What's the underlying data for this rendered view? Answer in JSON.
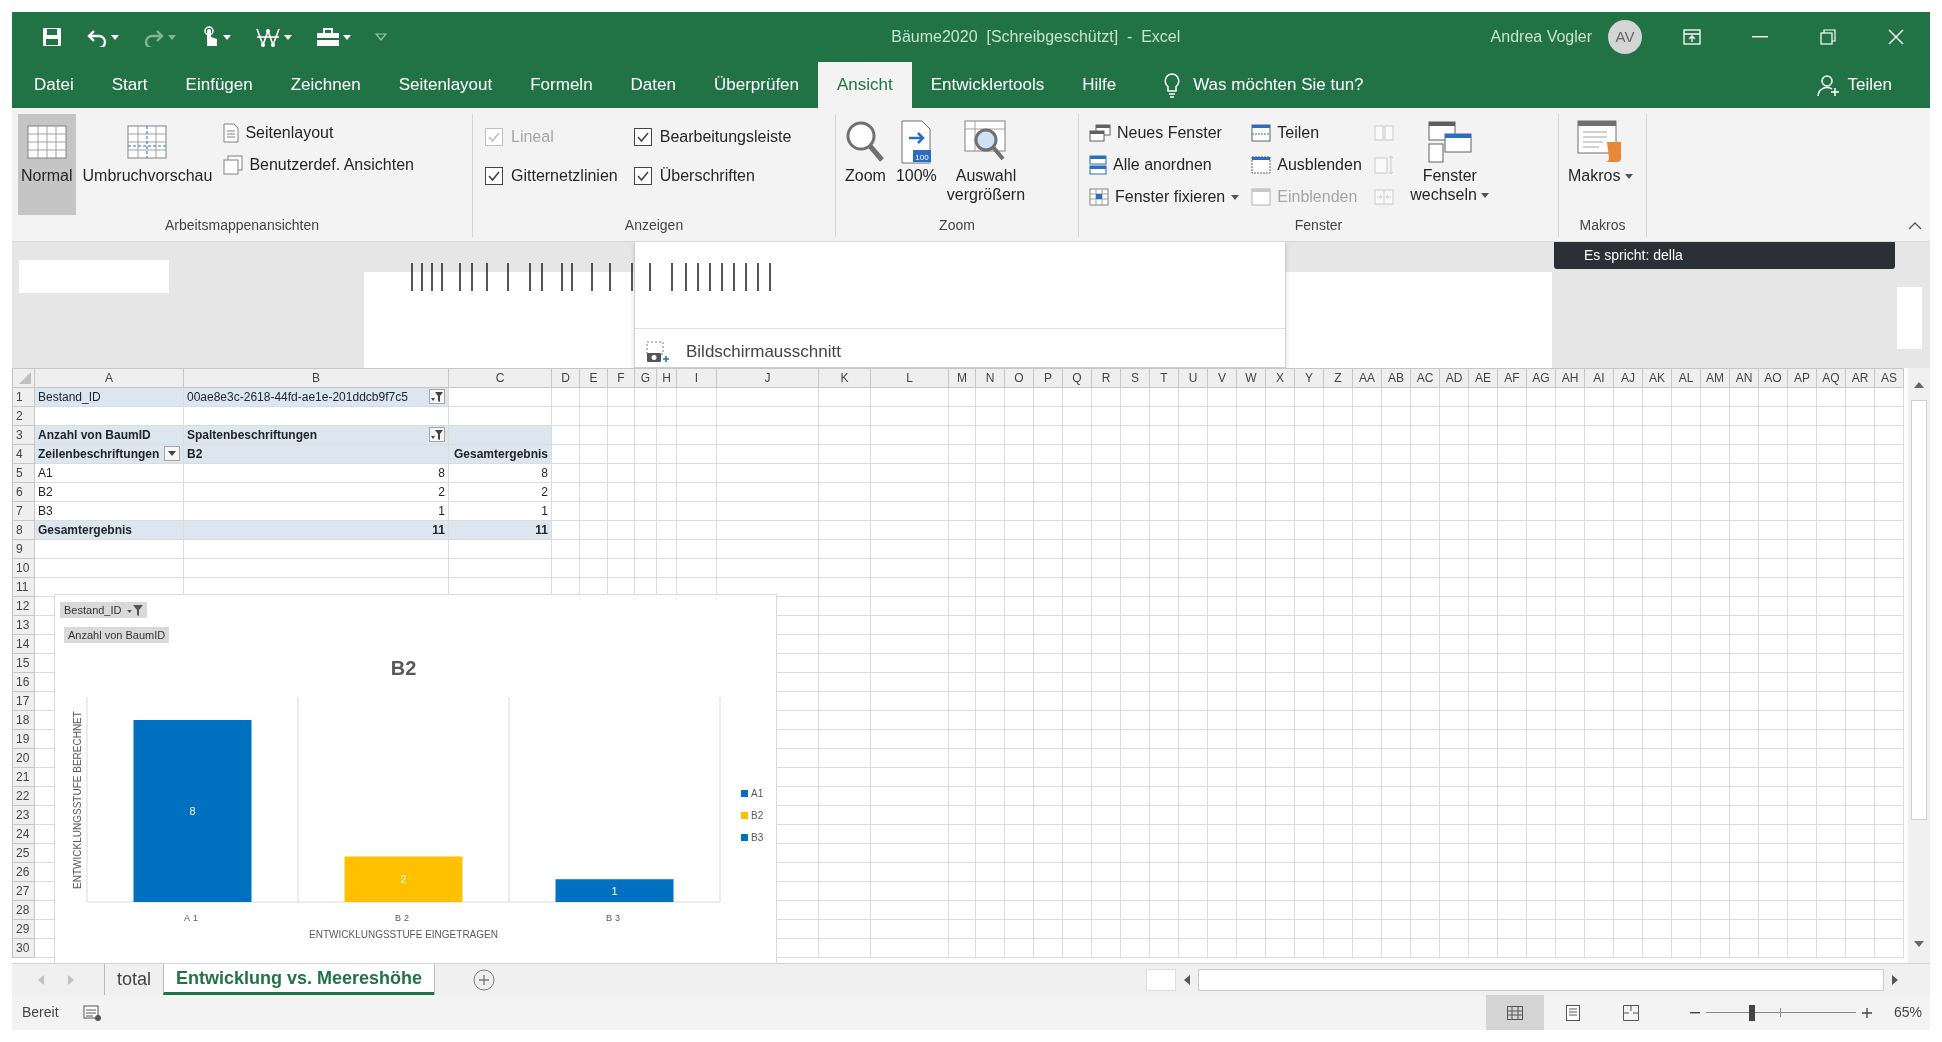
{
  "title_bar": {
    "title": "Bäume2020  [Schreibgeschützt]  -  Excel",
    "user": "Andrea Vogler",
    "avatar": "AV"
  },
  "quick_access": [
    {
      "disabled": false,
      "dropdown": false
    },
    {
      "disabled": false,
      "dropdown": true
    },
    {
      "disabled": true,
      "dropdown": true
    },
    {
      "disabled": false,
      "dropdown": true
    },
    {
      "disabled": false,
      "dropdown": true
    },
    {
      "disabled": false,
      "dropdown": true
    }
  ],
  "ribbon_tabs": [
    {
      "label": "Datei",
      "selected": false
    },
    {
      "label": "Start",
      "selected": false
    },
    {
      "label": "Einfügen",
      "selected": false
    },
    {
      "label": "Zeichnen",
      "selected": false
    },
    {
      "label": "Seitenlayout",
      "selected": false
    },
    {
      "label": "Formeln",
      "selected": false
    },
    {
      "label": "Daten",
      "selected": false
    },
    {
      "label": "Überprüfen",
      "selected": false
    },
    {
      "label": "Ansicht",
      "selected": true
    },
    {
      "label": "Entwicklertools",
      "selected": false
    },
    {
      "label": "Hilfe",
      "selected": false
    }
  ],
  "tell_me": "Was möchten Sie tun?",
  "share": "Teilen",
  "ribbon_groups": [
    {
      "label": "Arbeitsmappenansichten",
      "items": [
        {
          "kind": "large",
          "label": "Normal",
          "selected": true
        },
        {
          "kind": "large",
          "label": "Umbruchvorschau",
          "selected": false
        },
        {
          "kind": "stack",
          "items": [
            {
              "kind": "small",
              "label": "Seitenlayout",
              "disabled": false
            },
            {
              "kind": "small",
              "label": "Benutzerdef. Ansichten",
              "disabled": false
            }
          ]
        }
      ]
    },
    {
      "label": "Anzeigen",
      "items": [
        {
          "kind": "stack",
          "items": [
            {
              "kind": "checkbox",
              "label": "Lineal",
              "checked": true,
              "disabled": true
            },
            {
              "kind": "checkbox",
              "label": "Gitternetzlinien",
              "checked": true,
              "disabled": false
            }
          ]
        },
        {
          "kind": "stack",
          "items": [
            {
              "kind": "checkbox",
              "label": "Bearbeitungsleiste",
              "checked": true,
              "disabled": false
            },
            {
              "kind": "checkbox",
              "label": "Überschriften",
              "checked": true,
              "disabled": false
            }
          ]
        }
      ]
    },
    {
      "label": "Zoom",
      "items": [
        {
          "kind": "large",
          "label": "Zoom"
        },
        {
          "kind": "large",
          "label": "100%",
          "icon_text": "100"
        },
        {
          "kind": "large",
          "label": "Auswahl vergrößern"
        }
      ]
    },
    {
      "label": "Fenster",
      "items": [
        {
          "kind": "stack",
          "items": [
            {
              "kind": "small",
              "label": "Neues Fenster",
              "disabled": false
            },
            {
              "kind": "small",
              "label": "Alle anordnen",
              "disabled": false
            },
            {
              "kind": "small",
              "label": "Fenster fixieren",
              "disabled": false,
              "dropdown": true
            }
          ]
        },
        {
          "kind": "stack",
          "items": [
            {
              "kind": "small",
              "label": "Teilen",
              "disabled": false
            },
            {
              "kind": "small",
              "label": "Ausblenden",
              "disabled": false
            },
            {
              "kind": "small",
              "label": "Einblenden",
              "disabled": true
            }
          ]
        },
        {
          "kind": "stack",
          "items": [
            {
              "kind": "icon",
              "disabled": true
            },
            {
              "kind": "icon",
              "disabled": true
            },
            {
              "kind": "icon",
              "disabled": true
            }
          ]
        },
        {
          "kind": "large",
          "label": "Fenster wechseln",
          "dropdown": true
        }
      ]
    },
    {
      "label": "Makros",
      "items": [
        {
          "kind": "large",
          "label": "Makros",
          "dropdown": true
        }
      ]
    }
  ],
  "screenshot_menu": {
    "label": "Bildschirmausschnitt"
  },
  "tooltip": {
    "text": "Es spricht: della"
  },
  "sheet": {
    "columns": [
      "A",
      "B",
      "C",
      "D",
      "E",
      "F",
      "G",
      "H",
      "I",
      "J",
      "K",
      "L",
      "M",
      "N",
      "O",
      "P",
      "Q",
      "R",
      "S",
      "T",
      "U",
      "V",
      "W",
      "X",
      "Y",
      "Z",
      "AA",
      "AB",
      "AC",
      "AD",
      "AE",
      "AF",
      "AG",
      "AH",
      "AI",
      "AJ",
      "AK",
      "AL",
      "AM",
      "AN",
      "AO",
      "AP",
      "AQ",
      "AR",
      "AS"
    ],
    "rows": [
      {
        "header": "1",
        "cells": [
          {
            "text": "Bestand_ID",
            "shaded": true,
            "bold": false,
            "kind": "label"
          },
          {
            "text": "00ae8e3c-2618-44fd-ae1e-201ddcb9f7c5",
            "shaded": true,
            "bold": false,
            "kind": "label",
            "button": {
              "kind": "filter"
            }
          }
        ]
      },
      {
        "header": "2"
      },
      {
        "header": "3",
        "cells": [
          {
            "text": "Anzahl von BaumID",
            "shaded": true,
            "bold": true,
            "kind": "label"
          },
          {
            "text": "Spaltenbeschriftungen",
            "shaded": true,
            "bold": true,
            "kind": "label",
            "button": {
              "kind": "filter"
            }
          },
          {
            "shaded": true
          }
        ]
      },
      {
        "header": "4",
        "cells": [
          {
            "text": "Zeilenbeschriftungen",
            "shaded": true,
            "bold": true,
            "kind": "label",
            "button": {
              "kind": "dropdown"
            }
          },
          {
            "text": "B2",
            "shaded": true,
            "bold": true,
            "kind": "label"
          },
          {
            "text": "Gesamtergebnis",
            "shaded": true,
            "bold": true,
            "kind": "number"
          }
        ]
      },
      {
        "header": "5",
        "cells": [
          {
            "text": "A1",
            "shaded": false,
            "bold": false,
            "kind": "label"
          },
          {
            "text": "8",
            "shaded": false,
            "bold": false,
            "kind": "number"
          },
          {
            "text": "8",
            "shaded": false,
            "bold": false,
            "kind": "number"
          }
        ]
      },
      {
        "header": "6",
        "cells": [
          {
            "text": "B2",
            "shaded": false,
            "bold": false,
            "kind": "label"
          },
          {
            "text": "2",
            "shaded": false,
            "bold": false,
            "kind": "number"
          },
          {
            "text": "2",
            "shaded": false,
            "bold": false,
            "kind": "number"
          }
        ]
      },
      {
        "header": "7",
        "cells": [
          {
            "text": "B3",
            "shaded": false,
            "bold": false,
            "kind": "label"
          },
          {
            "text": "1",
            "shaded": false,
            "bold": false,
            "kind": "number"
          },
          {
            "text": "1",
            "shaded": false,
            "bold": false,
            "kind": "number"
          }
        ]
      },
      {
        "header": "8",
        "cells": [
          {
            "text": "Gesamtergebnis",
            "shaded": true,
            "bold": true,
            "kind": "label"
          },
          {
            "text": "11",
            "shaded": true,
            "bold": true,
            "kind": "number"
          },
          {
            "text": "11",
            "shaded": true,
            "bold": true,
            "kind": "number"
          }
        ]
      },
      {
        "header": "9"
      },
      {
        "header": "10"
      },
      {
        "header": "11"
      },
      {
        "header": "12"
      },
      {
        "header": "13"
      },
      {
        "header": "14"
      },
      {
        "header": "15"
      },
      {
        "header": "16"
      },
      {
        "header": "17"
      },
      {
        "header": "18"
      },
      {
        "header": "19"
      },
      {
        "header": "20"
      },
      {
        "header": "21"
      },
      {
        "header": "22"
      },
      {
        "header": "23"
      },
      {
        "header": "24"
      },
      {
        "header": "25"
      },
      {
        "header": "26"
      },
      {
        "header": "27"
      },
      {
        "header": "28"
      },
      {
        "header": "29"
      },
      {
        "header": "30"
      }
    ]
  },
  "pivot_chart": {
    "field_buttons": [
      {
        "label": "Bestand_ID",
        "filter": true
      },
      {
        "label": "Anzahl von BaumID",
        "filter": false
      }
    ],
    "chart_data": {
      "type": "bar",
      "title": "B2",
      "xlabel": "ENTWICKLUNGSSTUFE EINGETRAGEN",
      "ylabel": "ENTWICKLUNGSSTUFE BERECHNET",
      "categories": [
        "A1",
        "B2",
        "B3"
      ],
      "values": [
        8,
        2,
        1
      ],
      "data_labels": true
    },
    "legend": [
      {
        "label": "A1",
        "color": "#0070c0"
      },
      {
        "label": "B2",
        "color": "#ffc000"
      },
      {
        "label": "B3",
        "color": "#0070c0"
      }
    ]
  },
  "sheet_tabs": [
    {
      "label": "total",
      "selected": false
    },
    {
      "label": "Entwicklung vs. Meereshöhe",
      "selected": true
    }
  ],
  "status_bar": {
    "text": "Bereit",
    "views": [
      {
        "selected": true
      },
      {
        "selected": false
      },
      {
        "selected": false
      }
    ],
    "zoom": {
      "level": 0.31,
      "reading": "65%"
    }
  }
}
